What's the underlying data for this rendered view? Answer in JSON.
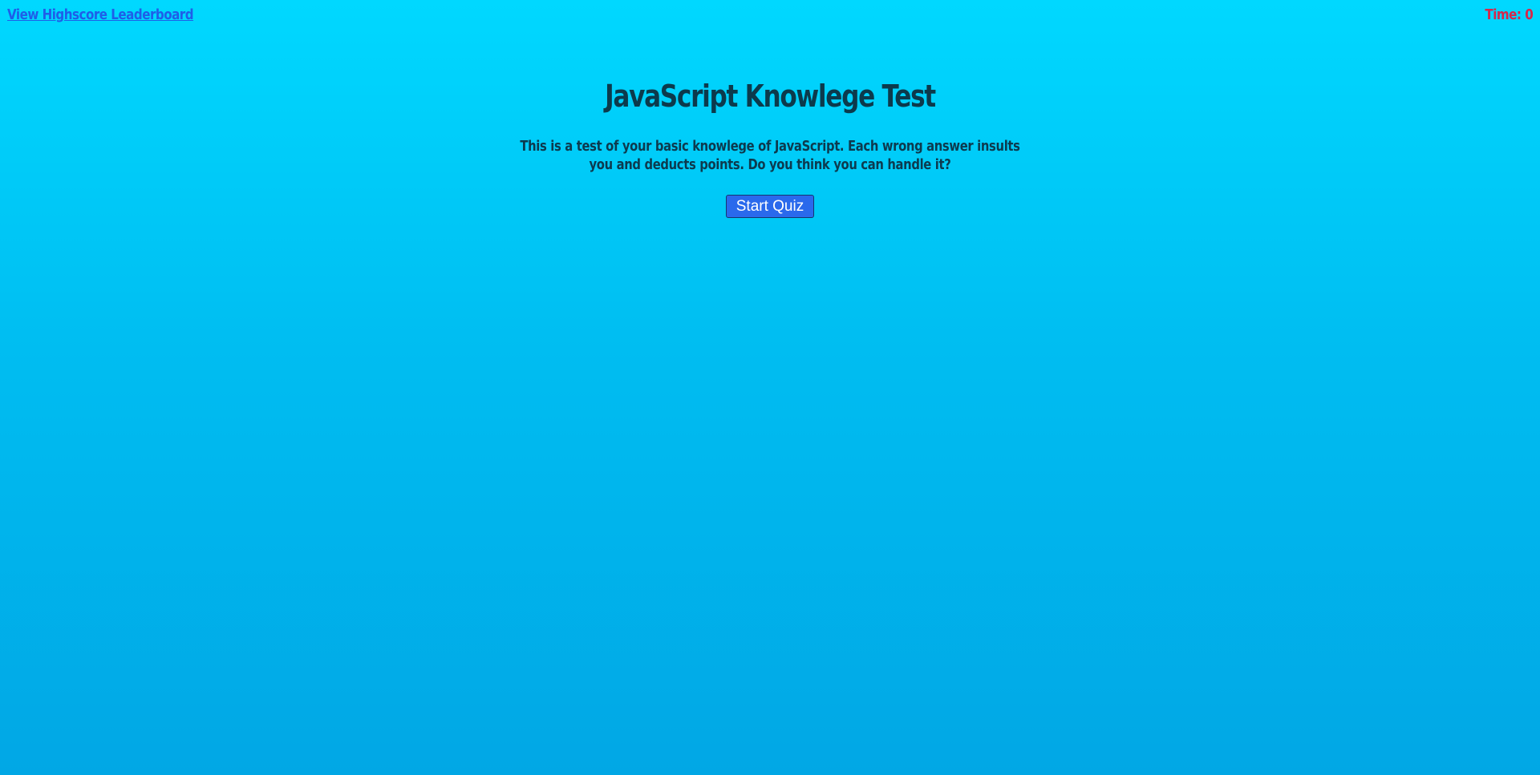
{
  "header": {
    "leaderboard_link": "View Highscore Leaderboard",
    "timer_label": "Time:",
    "timer_value": "0"
  },
  "main": {
    "title": "JavaScript Knowlege Test",
    "description": "This is a test of your basic knowlege of JavaScript. Each wrong answer insults you and deducts points. Do you think you can handle it?",
    "start_button": "Start Quiz"
  },
  "colors": {
    "background_top": "#00d8ff",
    "background_bottom": "#01a7e5",
    "link": "#1f5ee8",
    "timer": "#d7264a",
    "button": "#2a69ec",
    "text": "#0c3a4c"
  }
}
